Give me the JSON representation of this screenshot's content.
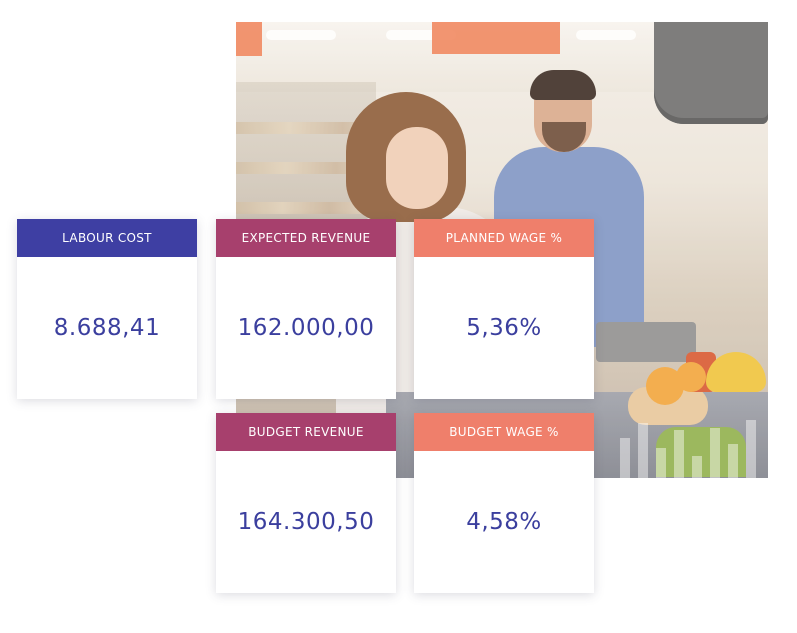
{
  "colors": {
    "navy": "#3e3fa3",
    "plum": "#a7406d",
    "coral": "#ef7f6b",
    "value_text": "#3b3f9e"
  },
  "kpis": {
    "labour_cost": {
      "label": "LABOUR COST",
      "value": "8.688,41"
    },
    "expected_revenue": {
      "label": "EXPECTED REVENUE",
      "value": "162.000,00"
    },
    "planned_wage": {
      "label": "PLANNED WAGE %",
      "value": "5,36%"
    },
    "budget_revenue": {
      "label": "BUDGET REVENUE",
      "value": "164.300,50"
    },
    "budget_wage": {
      "label": "BUDGET WAGE %",
      "value": "4,58%"
    }
  }
}
